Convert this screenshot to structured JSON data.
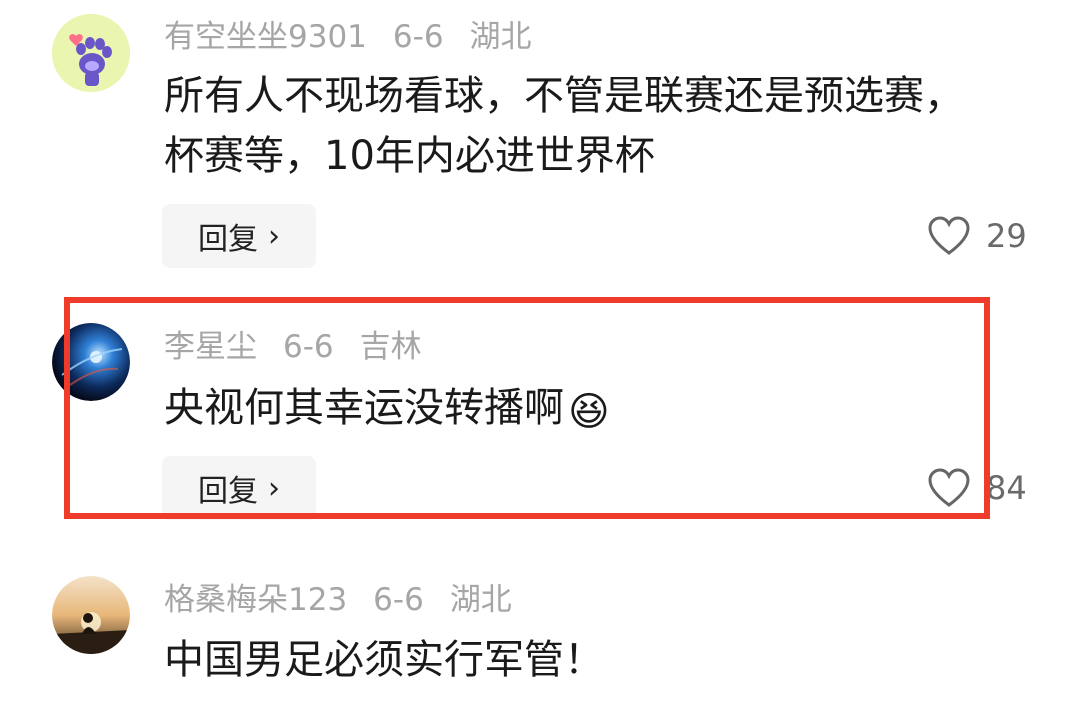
{
  "comments": [
    {
      "username": "有空坐坐9301",
      "date": "6-6",
      "location": "湖北",
      "text": "所有人不现场看球，不管是联赛还是预选赛，杯赛等，10年内必进世界杯",
      "reply_label": "回复",
      "likes": "29"
    },
    {
      "username": "李星尘",
      "date": "6-6",
      "location": "吉林",
      "text": "央视何其幸运没转播啊",
      "emoji": "😆",
      "reply_label": "回复",
      "likes": "84"
    },
    {
      "username": "格桑梅朵123",
      "date": "6-6",
      "location": "湖北",
      "text": "中国男足必须实行军管！"
    }
  ],
  "colors": {
    "highlight_border": "#ee3b2a",
    "meta_text": "#a6a6a6",
    "body_text": "#1a1a1a"
  }
}
